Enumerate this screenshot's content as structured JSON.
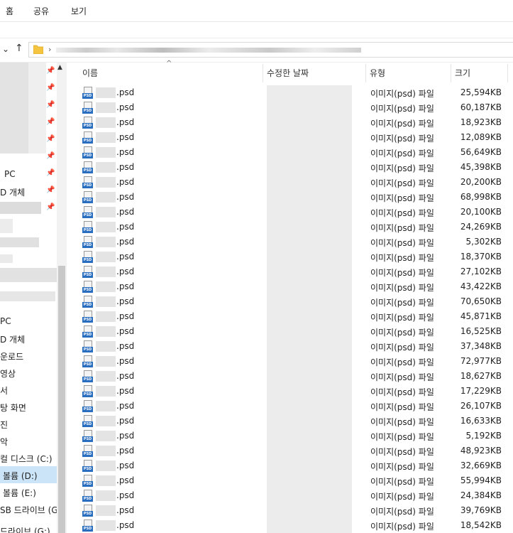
{
  "ribbon": {
    "tabs": [
      "홈",
      "공유",
      "보기"
    ]
  },
  "nav": {
    "back_chevron": "⌄",
    "up_arrow": "↑",
    "address_chevron": "›"
  },
  "sidebar": {
    "items": [
      {
        "label": "PC",
        "pinned": true
      },
      {
        "label": "D 개체",
        "pinned": true
      },
      {
        "label": "PC",
        "pinned": false
      },
      {
        "label": "D 개체",
        "pinned": false
      },
      {
        "label": "운로드",
        "pinned": false
      },
      {
        "label": "영상",
        "pinned": false
      },
      {
        "label": "서",
        "pinned": false
      },
      {
        "label": "탕 화면",
        "pinned": false
      },
      {
        "label": "진",
        "pinned": false
      },
      {
        "label": "악",
        "pinned": false
      },
      {
        "label": "컬 디스크 (C:)",
        "pinned": false
      },
      {
        "label": "볼륨 (D:)",
        "pinned": false
      },
      {
        "label": "볼륨 (E:)",
        "pinned": false
      },
      {
        "label": "SB 드라이브 (G",
        "pinned": false
      },
      {
        "label": "드라이브 (G:)",
        "pinned": false
      }
    ]
  },
  "columns": {
    "name": "이름",
    "modified": "수정한 날짜",
    "type": "유형",
    "size": "크기"
  },
  "files": [
    {
      "ext": ".psd",
      "type": "이미지(psd) 파일",
      "size": "25,594KB"
    },
    {
      "ext": ".psd",
      "type": "이미지(psd) 파일",
      "size": "60,187KB"
    },
    {
      "ext": ".psd",
      "type": "이미지(psd) 파일",
      "size": "18,923KB"
    },
    {
      "ext": ".psd",
      "type": "이미지(psd) 파일",
      "size": "12,089KB"
    },
    {
      "ext": ".psd",
      "type": "이미지(psd) 파일",
      "size": "56,649KB"
    },
    {
      "ext": ".psd",
      "type": "이미지(psd) 파일",
      "size": "45,398KB"
    },
    {
      "ext": ".psd",
      "type": "이미지(psd) 파일",
      "size": "20,200KB"
    },
    {
      "ext": ".psd",
      "type": "이미지(psd) 파일",
      "size": "68,998KB"
    },
    {
      "ext": ".psd",
      "type": "이미지(psd) 파일",
      "size": "20,100KB"
    },
    {
      "ext": ".psd",
      "type": "이미지(psd) 파일",
      "size": "24,269KB"
    },
    {
      "ext": ".psd",
      "type": "이미지(psd) 파일",
      "size": "5,302KB"
    },
    {
      "ext": ".psd",
      "type": "이미지(psd) 파일",
      "size": "18,370KB"
    },
    {
      "ext": ".psd",
      "type": "이미지(psd) 파일",
      "size": "27,102KB"
    },
    {
      "ext": ".psd",
      "type": "이미지(psd) 파일",
      "size": "43,422KB"
    },
    {
      "ext": ".psd",
      "type": "이미지(psd) 파일",
      "size": "70,650KB"
    },
    {
      "ext": ".psd",
      "type": "이미지(psd) 파일",
      "size": "45,871KB"
    },
    {
      "ext": ".psd",
      "type": "이미지(psd) 파일",
      "size": "16,525KB"
    },
    {
      "ext": ".psd",
      "type": "이미지(psd) 파일",
      "size": "37,348KB"
    },
    {
      "ext": ".psd",
      "type": "이미지(psd) 파일",
      "size": "72,977KB"
    },
    {
      "ext": ".psd",
      "type": "이미지(psd) 파일",
      "size": "18,627KB"
    },
    {
      "ext": ".psd",
      "type": "이미지(psd) 파일",
      "size": "17,229KB"
    },
    {
      "ext": ".psd",
      "type": "이미지(psd) 파일",
      "size": "26,107KB"
    },
    {
      "ext": ".psd",
      "type": "이미지(psd) 파일",
      "size": "16,633KB"
    },
    {
      "ext": ".psd",
      "type": "이미지(psd) 파일",
      "size": "5,192KB"
    },
    {
      "ext": ".psd",
      "type": "이미지(psd) 파일",
      "size": "48,923KB"
    },
    {
      "ext": ".psd",
      "type": "이미지(psd) 파일",
      "size": "32,669KB"
    },
    {
      "ext": ".psd",
      "type": "이미지(psd) 파일",
      "size": "55,994KB"
    },
    {
      "ext": ".psd",
      "type": "이미지(psd) 파일",
      "size": "24,384KB"
    },
    {
      "ext": ".psd",
      "type": "이미지(psd) 파일",
      "size": "39,769KB"
    },
    {
      "ext": ".psd",
      "type": "이미지(psd) 파일",
      "size": "18,542KB"
    }
  ],
  "icons": {
    "file": "psd-file-icon",
    "folder": "folder-icon",
    "pin": "pin-icon"
  },
  "colors": {
    "folder": "#f5c542",
    "psd_badge": "#2a6ec0",
    "blur": "#e4e4e4"
  }
}
